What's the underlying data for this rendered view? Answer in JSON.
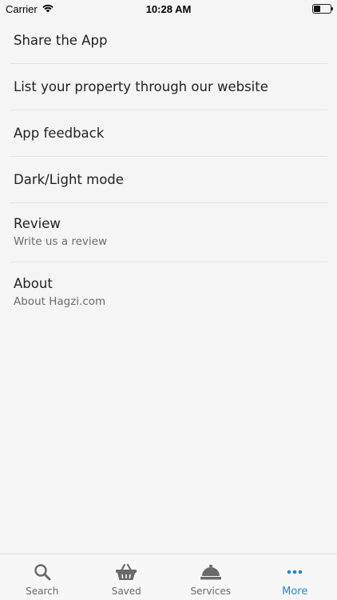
{
  "status_bar": {
    "carrier": "Carrier",
    "time": "10:28 AM",
    "battery_level": 0.4
  },
  "menu": {
    "items": [
      {
        "title": "Share the App",
        "subtitle": ""
      },
      {
        "title": "List your property through our website",
        "subtitle": ""
      },
      {
        "title": "App feedback",
        "subtitle": ""
      },
      {
        "title": "Dark/Light mode",
        "subtitle": ""
      },
      {
        "title": "Review",
        "subtitle": "Write us a review"
      },
      {
        "title": "About",
        "subtitle": "About Hagzi.com"
      }
    ]
  },
  "tab_bar": {
    "tabs": [
      {
        "label": "Search",
        "icon": "search-icon",
        "active": false
      },
      {
        "label": "Saved",
        "icon": "basket-icon",
        "active": false
      },
      {
        "label": "Services",
        "icon": "service-bell-icon",
        "active": false
      },
      {
        "label": "More",
        "icon": "more-dots-icon",
        "active": true
      }
    ],
    "active_color": "#2a86c6",
    "inactive_color": "#6a6a6a"
  }
}
